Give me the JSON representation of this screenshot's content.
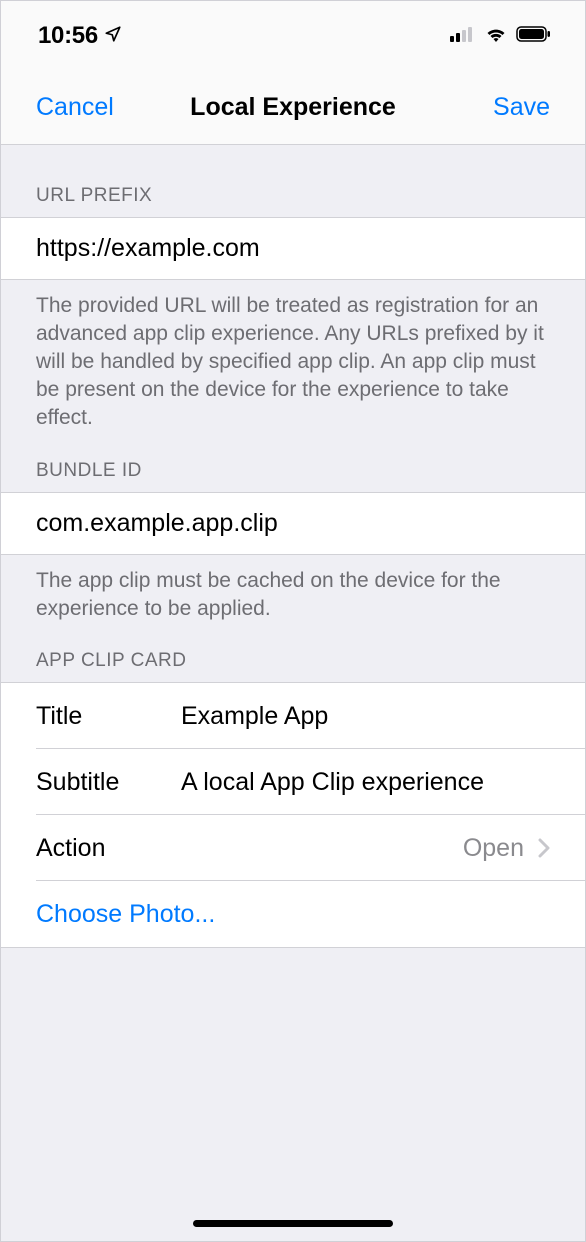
{
  "status": {
    "time": "10:56"
  },
  "nav": {
    "left": "Cancel",
    "title": "Local Experience",
    "right": "Save"
  },
  "urlPrefix": {
    "header": "URL PREFIX",
    "value": "https://example.com",
    "footer": "The provided URL will be treated as registration for an advanced app clip experience. Any URLs prefixed by it will be handled by specified app clip. An app clip must be present on the device for the experience to take effect."
  },
  "bundleId": {
    "header": "BUNDLE ID",
    "value": "com.example.app.clip",
    "footer": "The app clip must be cached on the device for the experience to be applied."
  },
  "card": {
    "header": "APP CLIP CARD",
    "titleLabel": "Title",
    "titleValue": "Example App",
    "subtitleLabel": "Subtitle",
    "subtitleValue": "A local App Clip experience",
    "actionLabel": "Action",
    "actionValue": "Open",
    "choosePhoto": "Choose Photo..."
  }
}
